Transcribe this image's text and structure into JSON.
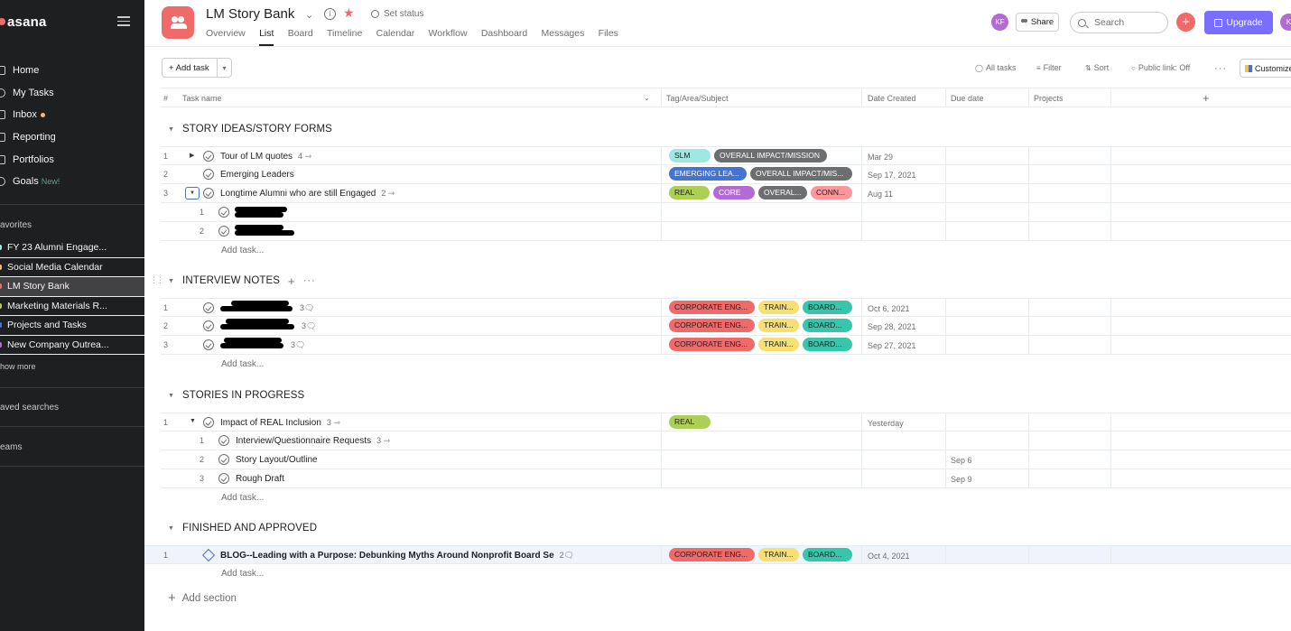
{
  "app": {
    "logo": "asana"
  },
  "sidebar": {
    "nav": [
      {
        "label": "Home",
        "icon": "home-icon"
      },
      {
        "label": "My Tasks",
        "icon": "check-circle-icon"
      },
      {
        "label": "Inbox",
        "icon": "bell-icon",
        "dot": true
      },
      {
        "label": "Reporting",
        "icon": "chart-icon"
      },
      {
        "label": "Portfolios",
        "icon": "folder-icon"
      },
      {
        "label": "Goals",
        "icon": "person-icon",
        "badge": "New!"
      }
    ],
    "favorites_label": "avorites",
    "favorites": [
      {
        "label": "FY 23 Alumni Engage..."
      },
      {
        "label": "Social Media Calendar"
      },
      {
        "label": "LM Story Bank",
        "selected": true
      },
      {
        "label": "Marketing Materials R..."
      },
      {
        "label": "Projects and Tasks"
      },
      {
        "label": "New Company Outrea..."
      }
    ],
    "show_more": "how more",
    "saved_searches": "aved searches",
    "teams": "eams"
  },
  "header": {
    "project_title": "LM Story Bank",
    "set_status": "Set status",
    "tabs": [
      "Overview",
      "List",
      "Board",
      "Timeline",
      "Calendar",
      "Workflow",
      "Dashboard",
      "Messages",
      "Files"
    ],
    "active_tab": "List",
    "avatar_initials": "KF",
    "share_label": "Share",
    "search_placeholder": "Search",
    "upgrade_label": "Upgrade",
    "avatar2_initials": "K",
    "accent_color": "#f06a6a"
  },
  "toolbar": {
    "add_task": "Add task",
    "all_tasks": "All tasks",
    "filter": "Filter",
    "sort": "Sort",
    "public_link": "Public link: Off",
    "customize": "Customize"
  },
  "columns": {
    "num": "#",
    "task_name": "Task name",
    "tag": "Tag/Area/Subject",
    "date_created": "Date Created",
    "due_date": "Due date",
    "projects": "Projects"
  },
  "tag_colors": {
    "SLM": "#9ee7e3",
    "OVERALL": "#6d6e6f",
    "EMERGING": "#4573d2",
    "REAL": "#aecf55",
    "CORE": "#b36bd4",
    "CONN": "#fc979a",
    "CORPORATE": "#f06a6a",
    "TRAIN": "#f8df72",
    "BOARD": "#37c5ab"
  },
  "sections": [
    {
      "title": "STORY IDEAS/STORY FORMS",
      "rows": [
        {
          "num": "1",
          "name": "Tour of LM quotes",
          "meta": "4",
          "tags": [
            "SLM",
            "OVERALL IMPACT/MISSION"
          ],
          "date": "Mar 29"
        },
        {
          "num": "2",
          "name": "Emerging Leaders",
          "tags": [
            "EMERGING LEA...",
            "OVERALL IMPACT/MIS..."
          ],
          "date": "Sep 17, 2021"
        },
        {
          "num": "3",
          "name": "Longtime Alumni who are still Engaged",
          "meta": "2",
          "tags": [
            "REAL",
            "CORE",
            "OVERAL...",
            "CONN..."
          ],
          "date": "Aug 11"
        },
        {
          "num": "1",
          "sub": true,
          "redacted": true
        },
        {
          "num": "2",
          "sub": true,
          "redacted": true
        }
      ],
      "add_task": "Add task..."
    },
    {
      "title": "INTERVIEW NOTES",
      "rows": [
        {
          "num": "1",
          "redacted": true,
          "meta": "3",
          "tags": [
            "CORPORATE ENG...",
            "TRAIN...",
            "BOARD..."
          ],
          "date": "Oct 6, 2021"
        },
        {
          "num": "2",
          "redacted": true,
          "meta": "3",
          "tags": [
            "CORPORATE ENG...",
            "TRAIN...",
            "BOARD..."
          ],
          "date": "Sep 28, 2021"
        },
        {
          "num": "3",
          "redacted": true,
          "meta": "3",
          "tags": [
            "CORPORATE ENG...",
            "TRAIN...",
            "BOARD..."
          ],
          "date": "Sep 27, 2021"
        }
      ],
      "add_task": "Add task..."
    },
    {
      "title": "STORIES IN PROGRESS",
      "rows": [
        {
          "num": "1",
          "name": "Impact of REAL Inclusion",
          "meta": "3",
          "tags": [
            "REAL"
          ],
          "date": "Yesterday"
        },
        {
          "num": "1",
          "sub": true,
          "name": "Interview/Questionnaire Requests",
          "meta": "3"
        },
        {
          "num": "2",
          "sub": true,
          "name": "Story Layout/Outline",
          "due": "Sep 6"
        },
        {
          "num": "3",
          "sub": true,
          "name": "Rough Draft",
          "due": "Sep 9"
        }
      ],
      "add_task": "Add task..."
    },
    {
      "title": "FINISHED AND APPROVED",
      "rows": [
        {
          "num": "1",
          "name": "BLOG--Leading with a Purpose: Debunking Myths Around Nonprofit Board Se",
          "meta": "2",
          "tags": [
            "CORPORATE ENG...",
            "TRAIN...",
            "BOARD..."
          ],
          "date": "Oct 4, 2021",
          "milestone": true
        }
      ],
      "add_task": "Add task..."
    }
  ],
  "add_section": "Add section"
}
